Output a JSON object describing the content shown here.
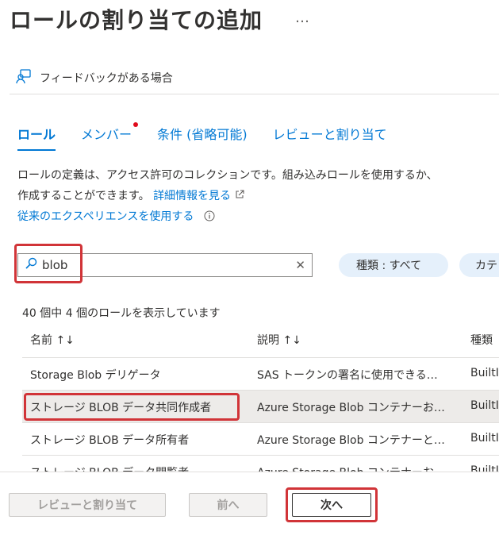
{
  "header": {
    "title": "ロールの割り当ての追加",
    "more": "…"
  },
  "feedback": {
    "label": "フィードバックがある場合"
  },
  "tabs": [
    {
      "label": "ロール",
      "active": true
    },
    {
      "label": "メンバー",
      "badge": true
    },
    {
      "label": "条件 (省略可能)"
    },
    {
      "label": "レビューと割り当て"
    }
  ],
  "description": {
    "line1": "ロールの定義は、アクセス許可のコレクションです。組み込みロールを使用するか、",
    "line2": "作成することができます。",
    "learn_more": "詳細情報を見る",
    "classic_link": "従来のエクスペリエンスを使用する"
  },
  "search": {
    "value": "blob",
    "placeholder": ""
  },
  "filters": {
    "type_label": "種類 : すべて",
    "category_label": "カテ"
  },
  "results_count": "40 個中 4 個のロールを表示しています",
  "table": {
    "columns": [
      "名前 ↑↓",
      "説明 ↑↓",
      "種類"
    ],
    "rows": [
      {
        "name": "Storage Blob デリゲータ",
        "description": "SAS トークンの署名に使用できる…",
        "type": "BuiltI"
      },
      {
        "name": "ストレージ BLOB データ共同作成者",
        "description": "Azure Storage Blob コンテナーお…",
        "type": "BuiltI",
        "selected": true
      },
      {
        "name": "ストレージ BLOB データ所有者",
        "description": "Azure Storage Blob コンテナーと…",
        "type": "BuiltI"
      },
      {
        "name": "ストレージ BLOB データ閲覧者",
        "description": "Azure Storage Blob コンテナーお…",
        "type": "BuiltI"
      }
    ]
  },
  "footer": {
    "review_label": "レビューと割り当て",
    "prev_label": "前へ",
    "next_label": "次へ"
  },
  "colors": {
    "accent": "#0078d4",
    "highlight": "#d13438"
  }
}
